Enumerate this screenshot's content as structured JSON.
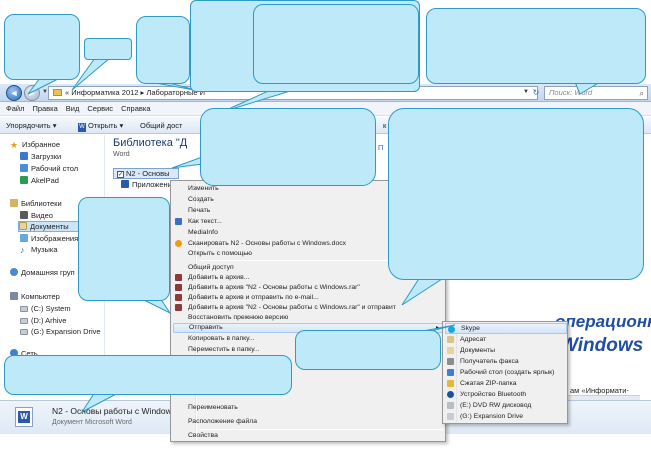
{
  "window": {
    "back_icon": "back-arrow-icon",
    "forward_icon": "forward-arrow-icon",
    "address_path": "« Информатика 2012 ▸ Лабораторные И",
    "search_placeholder": "Поиск: Word",
    "refresh_glyph": "↻"
  },
  "menubar": [
    "Файл",
    "Правка",
    "Вид",
    "Сервис",
    "Справка"
  ],
  "toolbar": {
    "organize": "Упорядочить ▾",
    "open": "Открыть ▾",
    "share": "Общий дост",
    "tail": "к"
  },
  "navpane": {
    "favorites": "Избранное",
    "downloads": "Загрузки",
    "desktop": "Рабочий стол",
    "akelpad": "AkelPad",
    "libraries": "Библиотеки",
    "video": "Видео",
    "documents": "Документы",
    "images": "Изображения",
    "music": "Музыка",
    "homegroup": "Домашняя груп",
    "computer": "Компьютер",
    "drive_c": "(C:) System",
    "drive_d": "(D:) Arhive",
    "drive_g": "(G:) Expansion Drive",
    "network": "Сеть"
  },
  "content": {
    "library_title": "Библиотека \"Д",
    "library_sub": "Word",
    "arrange_short": "П",
    "file_name": "N2 - Основы",
    "file_child": "Приложение",
    "preview_line1": "операционной",
    "preview_line2": "Windows",
    "preview_line3": "ам «Информати-"
  },
  "details": {
    "file_name": "N2 - Основы работы с Windows.doc",
    "file_type": "Документ Microsoft Word"
  },
  "context_menu": {
    "items": [
      "Изменить",
      "Создать",
      "Печать",
      "Как текст...",
      "MediaInfo",
      "Сканировать N2 - Основы работы с Windows.docx",
      "Открыть с помощью",
      "Общий доступ",
      "Добавить в архив...",
      "Добавить в архив \"N2 - Основы работы с Windows.rar\"",
      "Добавить в архив и отправить по e-mail...",
      "Добавить в архив \"N2 - Основы работы с Windows.rar\" и отправит",
      "Восстановить прежнюю версию",
      "Отправить",
      "Копировать в папку...",
      "Переместить в папку...",
      "Переименовать",
      "Расположение файла",
      "Свойства"
    ],
    "submenu_arrow": "▸"
  },
  "send_to_menu": {
    "items": [
      "Skype",
      "Адресат",
      "Документы",
      "Получатель факса",
      "Рабочий стол (создать ярлык)",
      "Сжатая ZIP-папка",
      "Устройство Bluetooth",
      "(E:) DVD RW дисковод",
      "(G:) Expansion Drive"
    ]
  },
  "colors": {
    "bubble_fill": "#bde9f9",
    "bubble_border": "#2e9bc4",
    "menu_bg": "#f0f0f0",
    "selection": "#d4e5f8",
    "preview_text": "#1f4ea3"
  }
}
